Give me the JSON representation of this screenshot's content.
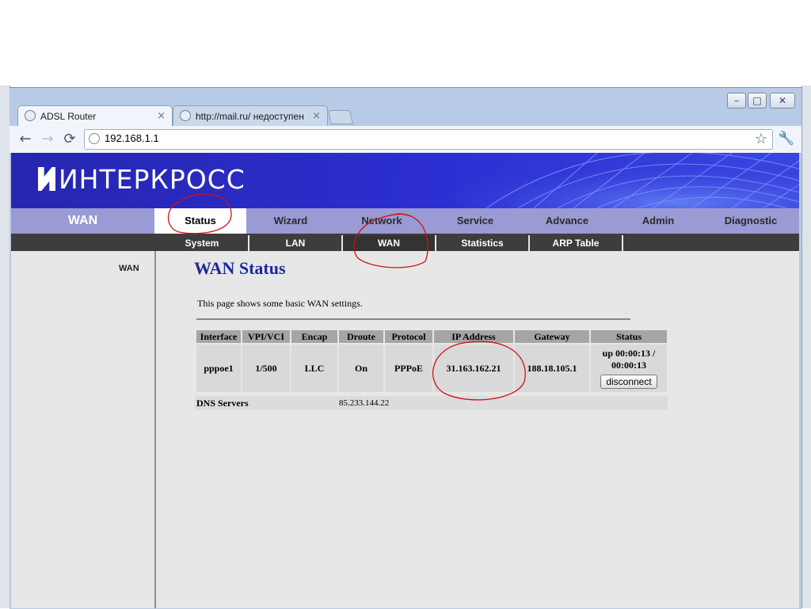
{
  "browser": {
    "tabs": [
      {
        "label": "ADSL Router",
        "active": true
      },
      {
        "label": "http://mail.ru/ недоступен",
        "active": false
      }
    ],
    "address": "192.168.1.1",
    "window_controls": {
      "minimize": "–",
      "maximize": "□",
      "close": "✕"
    },
    "icons": {
      "back": "←",
      "forward": "→",
      "reload": "⟳",
      "bookmark": "☆",
      "menu": "🔧",
      "close_tab": "×"
    }
  },
  "page": {
    "brand": "ИНТЕРКРОСС",
    "section_title": "WAN",
    "main_nav": [
      "Status",
      "Wizard",
      "Network",
      "Service",
      "Advance",
      "Admin",
      "Diagnostic"
    ],
    "active_main_nav": "Status",
    "sub_nav": [
      "System",
      "LAN",
      "WAN",
      "Statistics",
      "ARP Table"
    ],
    "active_sub_nav": "WAN",
    "left_menu": [
      "WAN"
    ],
    "title": "WAN Status",
    "description": "This page shows some basic WAN settings.",
    "table": {
      "headers": [
        "Interface",
        "VPI/VCI",
        "Encap",
        "Droute",
        "Protocol",
        "IP Address",
        "Gateway",
        "Status"
      ],
      "rows": [
        {
          "interface": "pppoe1",
          "vpi_vci": "1/500",
          "encap": "LLC",
          "droute": "On",
          "protocol": "PPPoE",
          "ip_address": "31.163.162.21",
          "gateway": "188.18.105.1",
          "status": "up 00:00:13 / 00:00:13",
          "action": "disconnect"
        }
      ]
    },
    "dns": {
      "label": "DNS Servers",
      "value": "85.233.144.22"
    }
  },
  "colors": {
    "banner": "#2c2fd2",
    "nav": "#9a9ad4",
    "subnav": "#3d3d3d",
    "title": "#1c2a9a",
    "annotation": "#d01010"
  }
}
